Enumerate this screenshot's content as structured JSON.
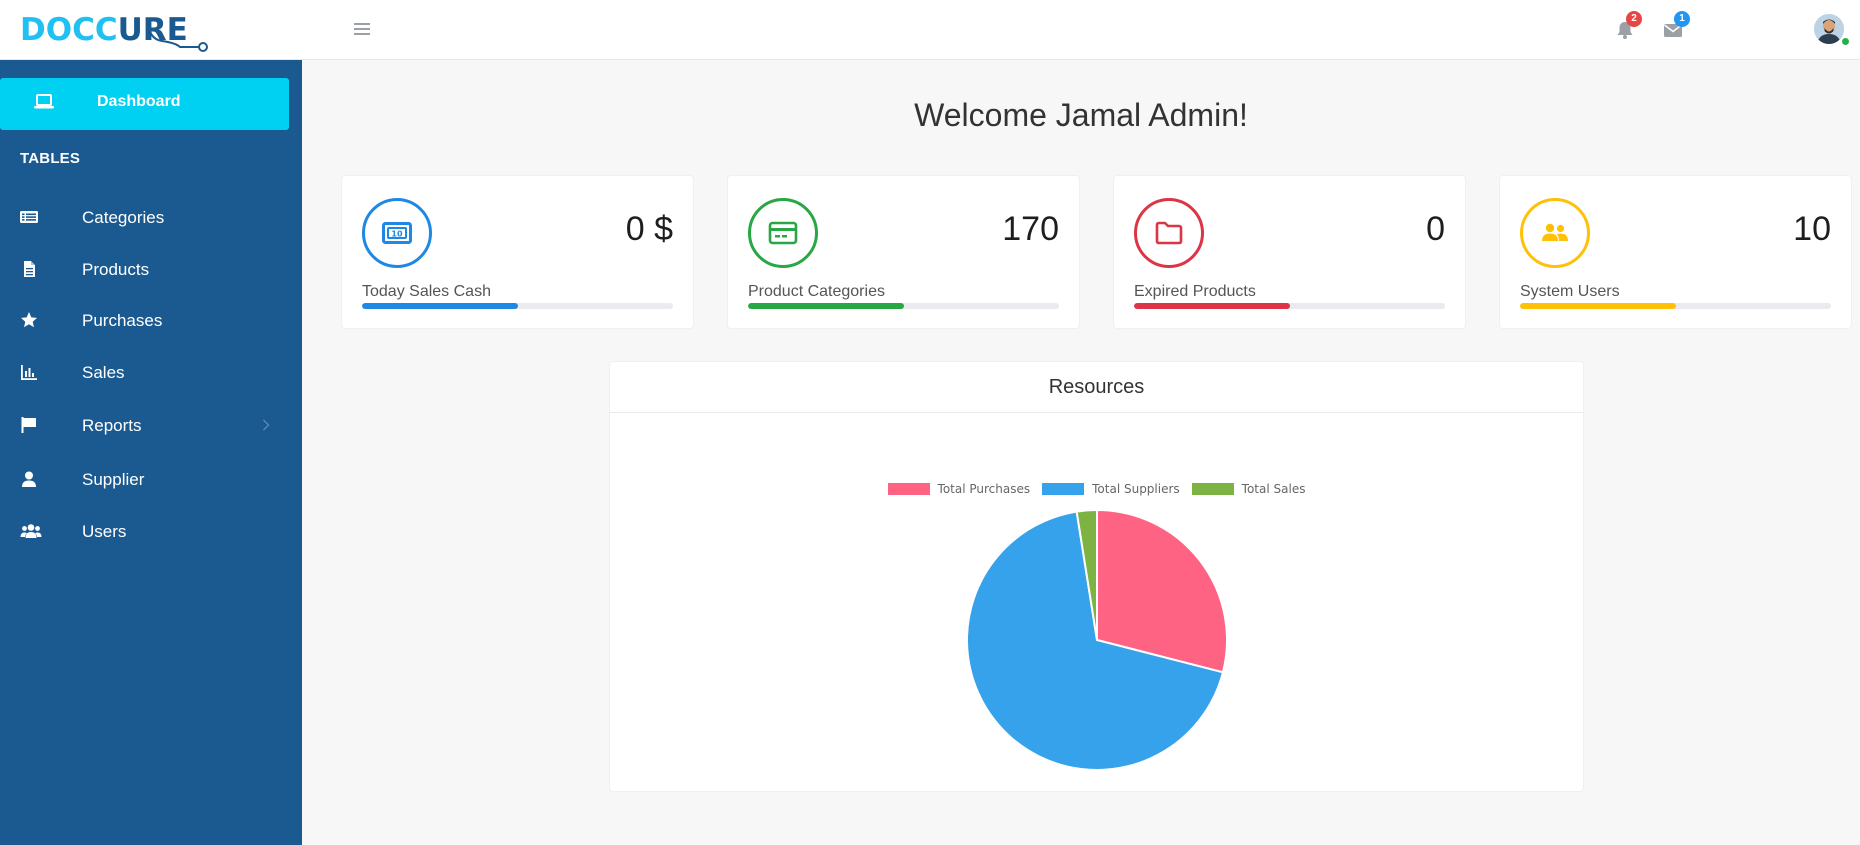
{
  "header": {
    "logo_part1": "DOCC",
    "logo_part2": "URE",
    "notifications_count": "2",
    "messages_count": "1"
  },
  "sidebar": {
    "active_item": {
      "label": "Dashboard",
      "icon": "laptop-icon"
    },
    "section_title": "TABLES",
    "items": [
      {
        "label": "Categories",
        "icon": "list-icon"
      },
      {
        "label": "Products",
        "icon": "file-icon"
      },
      {
        "label": "Purchases",
        "icon": "star-icon"
      },
      {
        "label": "Sales",
        "icon": "bar-chart-icon"
      },
      {
        "label": "Reports",
        "icon": "flag-icon",
        "has_submenu": true
      },
      {
        "label": "Supplier",
        "icon": "user-icon"
      },
      {
        "label": "Users",
        "icon": "users-icon"
      }
    ]
  },
  "main": {
    "welcome": "Welcome Jamal Admin!",
    "cards": [
      {
        "value": "0 $",
        "label": "Today Sales Cash",
        "color": "#1e88e5",
        "progress": 0.5,
        "icon": "money-icon"
      },
      {
        "value": "170",
        "label": "Product Categories",
        "color": "#28a745",
        "progress": 0.5,
        "icon": "card-icon"
      },
      {
        "value": "0",
        "label": "Expired Products",
        "color": "#dc3545",
        "progress": 0.5,
        "icon": "folder-icon"
      },
      {
        "value": "10",
        "label": "System Users",
        "color": "#ffc107",
        "progress": 0.5,
        "icon": "users-icon"
      }
    ]
  },
  "chart_data": {
    "type": "pie",
    "title": "Resources",
    "labels": [
      "Total Purchases",
      "Total Suppliers",
      "Total Sales"
    ],
    "values": [
      29,
      68.5,
      2.5
    ],
    "colors": [
      "#ff6384",
      "#36a2eb",
      "#7cb342"
    ],
    "legend": "top"
  }
}
